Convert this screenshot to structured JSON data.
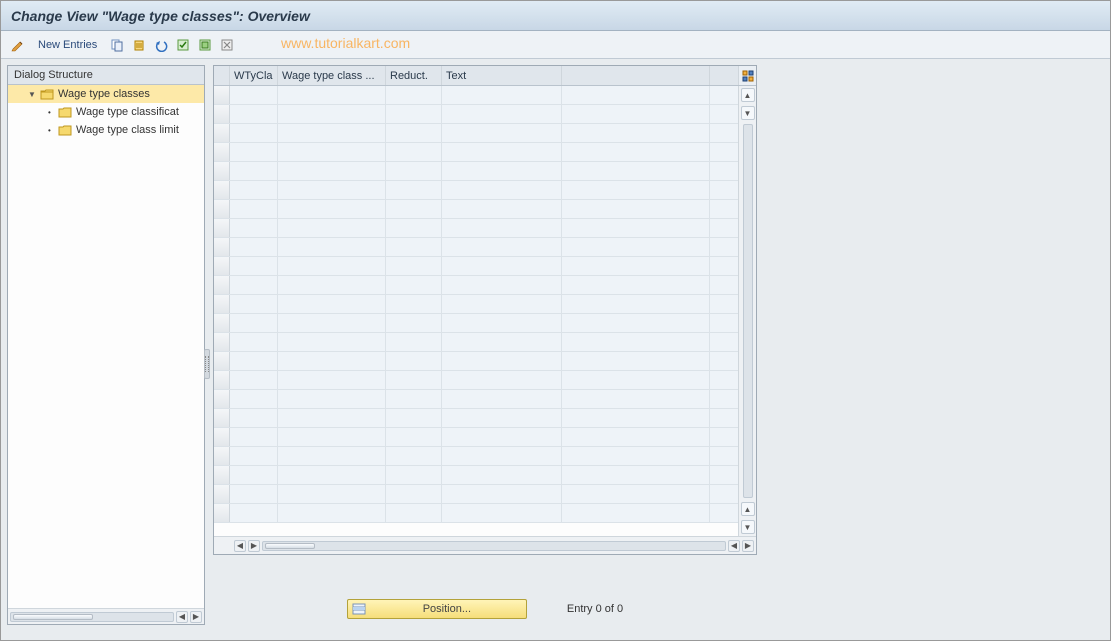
{
  "title": "Change View \"Wage type classes\": Overview",
  "watermark": "www.tutorialkart.com",
  "toolbar": {
    "new_entries_label": "New Entries"
  },
  "sidebar": {
    "header": "Dialog Structure",
    "items": [
      {
        "label": "Wage type classes",
        "selected": true,
        "level": 1,
        "expanded": true
      },
      {
        "label": "Wage type classificat",
        "selected": false,
        "level": 2
      },
      {
        "label": "Wage type class limit",
        "selected": false,
        "level": 2
      }
    ]
  },
  "grid": {
    "columns": [
      "WTyCla",
      "Wage type class ...",
      "Reduct.",
      "Text"
    ],
    "row_count": 23,
    "rows": []
  },
  "footer": {
    "position_label": "Position...",
    "entry_text": "Entry 0 of 0"
  }
}
